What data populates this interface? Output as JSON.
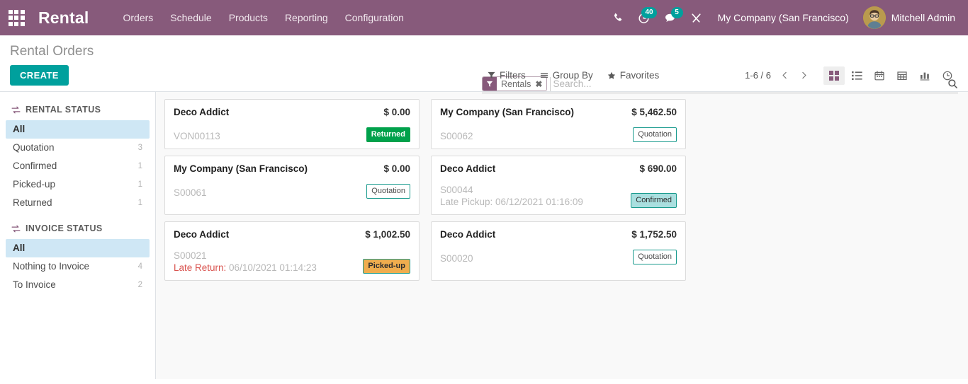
{
  "navbar": {
    "apps_icon": "apps-grid-icon",
    "brand": "Rental",
    "menu": [
      {
        "label": "Orders"
      },
      {
        "label": "Schedule"
      },
      {
        "label": "Products"
      },
      {
        "label": "Reporting"
      },
      {
        "label": "Configuration"
      }
    ],
    "icons": {
      "phone": "phone-icon",
      "activities": "clock-icon",
      "messages": "chat-icon",
      "debug": "tools-icon"
    },
    "activities_count": "40",
    "messages_count": "5",
    "company": "My Company (San Francisco)",
    "user": "Mitchell Admin",
    "bg_color": "#875a7b"
  },
  "control_panel": {
    "page_title": "Rental Orders",
    "create_label": "CREATE",
    "create_color": "#00a09d",
    "search": {
      "facet_label": "Rentals",
      "facet_close": "✖",
      "placeholder": "Search...",
      "value": ""
    },
    "tools": [
      {
        "label": "Filters",
        "icon": "filter-icon"
      },
      {
        "label": "Group By",
        "icon": "bars-icon"
      },
      {
        "label": "Favorites",
        "icon": "star-icon"
      }
    ],
    "pager": "1-6 / 6",
    "views": [
      {
        "name": "kanban",
        "active": true
      },
      {
        "name": "list",
        "active": false
      },
      {
        "name": "calendar",
        "active": false
      },
      {
        "name": "pivot",
        "active": false
      },
      {
        "name": "graph",
        "active": false
      },
      {
        "name": "activity",
        "active": false
      }
    ]
  },
  "sidebar": {
    "sections": [
      {
        "title": "RENTAL STATUS",
        "icon": "exchange-icon",
        "items": [
          {
            "label": "All",
            "count": "",
            "active": true
          },
          {
            "label": "Quotation",
            "count": "3",
            "active": false
          },
          {
            "label": "Confirmed",
            "count": "1",
            "active": false
          },
          {
            "label": "Picked-up",
            "count": "1",
            "active": false
          },
          {
            "label": "Returned",
            "count": "1",
            "active": false
          }
        ]
      },
      {
        "title": "INVOICE STATUS",
        "icon": "exchange-icon",
        "items": [
          {
            "label": "All",
            "count": "",
            "active": true
          },
          {
            "label": "Nothing to Invoice",
            "count": "4",
            "active": false
          },
          {
            "label": "To Invoice",
            "count": "2",
            "active": false
          }
        ]
      }
    ]
  },
  "kanban": {
    "cards": [
      {
        "partner": "Deco Addict",
        "amount": "$ 0.00",
        "reference": "VON00113",
        "late_label": "",
        "late_date": "",
        "late_is_red": false,
        "state": "Returned",
        "state_class": "state-returned"
      },
      {
        "partner": "My Company (San Francisco)",
        "amount": "$ 5,462.50",
        "reference": "S00062",
        "late_label": "",
        "late_date": "",
        "late_is_red": false,
        "state": "Quotation",
        "state_class": "state-quotation"
      },
      {
        "partner": "My Company (San Francisco)",
        "amount": "$ 0.00",
        "reference": "S00061",
        "late_label": "",
        "late_date": "",
        "late_is_red": false,
        "state": "Quotation",
        "state_class": "state-quotation"
      },
      {
        "partner": "Deco Addict",
        "amount": "$ 690.00",
        "reference": "S00044",
        "late_label": "Late Pickup:",
        "late_date": "06/12/2021 01:16:09",
        "late_is_red": false,
        "state": "Confirmed",
        "state_class": "state-confirmed"
      },
      {
        "partner": "Deco Addict",
        "amount": "$ 1,002.50",
        "reference": "S00021",
        "late_label": "Late Return:",
        "late_date": "06/10/2021 01:14:23",
        "late_is_red": true,
        "state": "Picked-up",
        "state_class": "state-pickedup"
      },
      {
        "partner": "Deco Addict",
        "amount": "$ 1,752.50",
        "reference": "S00020",
        "late_label": "",
        "late_date": "",
        "late_is_red": false,
        "state": "Quotation",
        "state_class": "state-quotation"
      }
    ]
  }
}
